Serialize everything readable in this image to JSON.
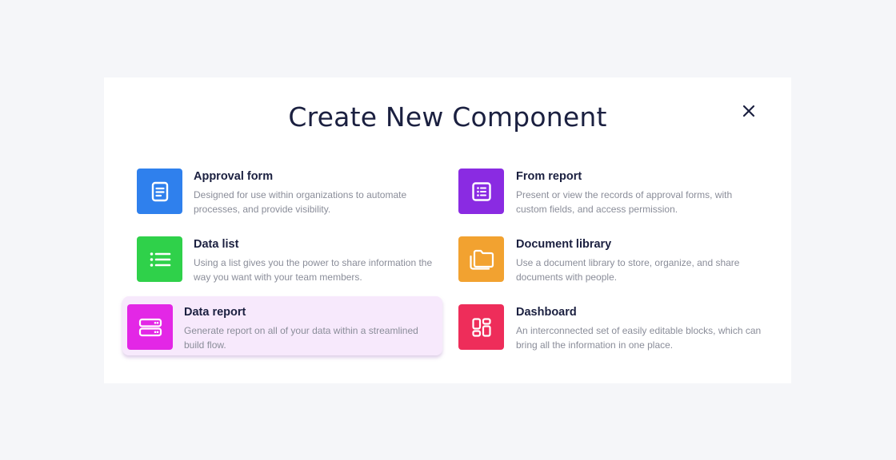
{
  "dialog": {
    "title": "Create New Component",
    "close_icon": "close-icon"
  },
  "options": [
    {
      "id": "approval-form",
      "title": "Approval form",
      "description": "Designed for use within organizations to automate processes, and provide visibility.",
      "icon": "document-icon",
      "color": "#2f80ed"
    },
    {
      "id": "from-report",
      "title": "From report",
      "description": "Present or view the records of approval forms, with custom fields, and access permission.",
      "icon": "list-box-icon",
      "color": "#8a2be2"
    },
    {
      "id": "data-list",
      "title": "Data list",
      "description": "Using a list gives you the power to share information the way you want with your team members.",
      "icon": "list-icon",
      "color": "#2fd14a"
    },
    {
      "id": "document-library",
      "title": "Document library",
      "description": "Use a document library to store, organize, and share documents with people.",
      "icon": "folder-icon",
      "color": "#f2a230"
    },
    {
      "id": "data-report",
      "title": "Data report",
      "description": "Generate report on all of your data within a streamlined build flow.",
      "icon": "server-icon",
      "color": "#e327e6",
      "highlighted": true
    },
    {
      "id": "dashboard",
      "title": "Dashboard",
      "description": "An interconnected set of easily editable blocks, which can bring all the information in one place.",
      "icon": "dashboard-grid-icon",
      "color": "#ee2d5a"
    }
  ]
}
